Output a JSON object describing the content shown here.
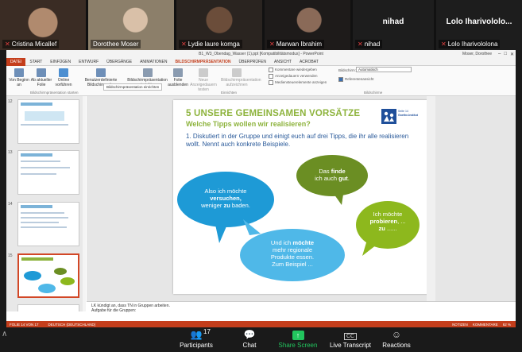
{
  "gallery": {
    "tiles": [
      {
        "name": "Cristina Micallef",
        "muted": true,
        "color": "#6b4c3a"
      },
      {
        "name": "Dorothee Moser",
        "muted": false,
        "color": "#8c7f6a"
      },
      {
        "name": "Lydie laure komga",
        "muted": true,
        "color": "#4a3d34"
      },
      {
        "name": "Marwan Ibrahim",
        "muted": true,
        "color": "#3b3431"
      },
      {
        "name": "nihad",
        "muted": true,
        "big": "nihad"
      },
      {
        "name": "Lolo Iharivololona",
        "muted": true,
        "big": "Lolo Iharivololo..."
      }
    ]
  },
  "ppt": {
    "title": "B1_W3_Obendag_Wasser (1).ppt [Kompatibilitätsmodus] - PowerPoint",
    "user": "Moser, Dorothee",
    "tabs": [
      "DATEI",
      "START",
      "EINFÜGEN",
      "ENTWURF",
      "ÜBERGÄNGE",
      "ANIMATIONEN",
      "BILDSCHIRMPRÄSENTATION",
      "ÜBERPRÜFEN",
      "ANSICHT",
      "ACROBAT"
    ],
    "ribbon": {
      "btn1": "Von Beginn an",
      "btn2": "Ab aktueller Folie",
      "btn3": "Online vorführen",
      "btn4": "Benutzerdefinierte Bildschirmpräs.",
      "grp1": "Bildschirmpräsentation starten",
      "btn5": "Bildschirmpräsentation einrichten",
      "btn6": "Folie ausblenden",
      "btn7": "Neue Anzeigedauern testen",
      "btn8": "Bildschirmpräsentation aufzeichnen",
      "tooltip": "Bildschirmpräsentation einrichten",
      "chk1": "Kommentare wiedergeben",
      "chk2": "Anzeigedauern verwenden",
      "chk3": "Mediensteuerelemente anzeigen",
      "grp2": "Einrichten",
      "monitor_label": "Bildschirm:",
      "monitor_value": "Automatisch",
      "presenter": "Referentenansicht",
      "grp3": "Bildschirme"
    },
    "thumb_numbers": [
      "12",
      "13",
      "14",
      "15"
    ],
    "slide": {
      "title": "5 UNSERE GEMEINSAMEN VORSÄTZE",
      "subtitle": "Welche Tipps wollen wir realisieren?",
      "logo_text_1": "Seite 14",
      "logo_text_2": "Goethe-Institut",
      "task": "1. Diskutiert in der Gruppe und einigt euch auf drei Tipps, die ihr alle realisieren wollt. Nennt auch konkrete Beispiele.",
      "b1_pre": "Also ich möchte",
      "b1_bold": "versuchen,",
      "b1_post": "weniger ",
      "b1_bold2": "zu",
      "b1_post2": " baden.",
      "b2_pre": "Das ",
      "b2_bold": "finde",
      "b2_mid": "ich auch ",
      "b2_bold2": "gut",
      "b2_post": ".",
      "b3_pre": "Ich möchte",
      "b3_bold": "probieren",
      "b3_mid": ", ...",
      "b3_bold2": "zu",
      "b3_post": " ......",
      "b4_pre": "Und ich ",
      "b4_bold": "möchte",
      "b4_l2": "mehr regionale",
      "b4_l3": "Produkte essen.",
      "b4_l4": "Zum Beispiel ..."
    },
    "notes_line1": "LK kündigt an, dass TN in Gruppen arbeiten.",
    "notes_line2": "Aufgabe für die Gruppen:",
    "status_left": "FOLIE 14 VON 17",
    "status_lang": "DEUTSCH (DEUTSCHLAND)",
    "status_notes": "NOTIZEN",
    "status_comments": "KOMMENTARE",
    "zoom_pct": "62 %"
  },
  "zoom": {
    "participants_label": "Participants",
    "participants_count": "17",
    "chat_label": "Chat",
    "share_label": "Share Screen",
    "transcript_label": "Live Transcript",
    "reactions_label": "Reactions"
  },
  "colors": {
    "bubble_blue": "#1e9ad6",
    "bubble_green": "#6b8e23",
    "bubble_lime": "#8db81d",
    "bubble_lightblue": "#4fb8e8",
    "accent": "#c43e1c"
  }
}
